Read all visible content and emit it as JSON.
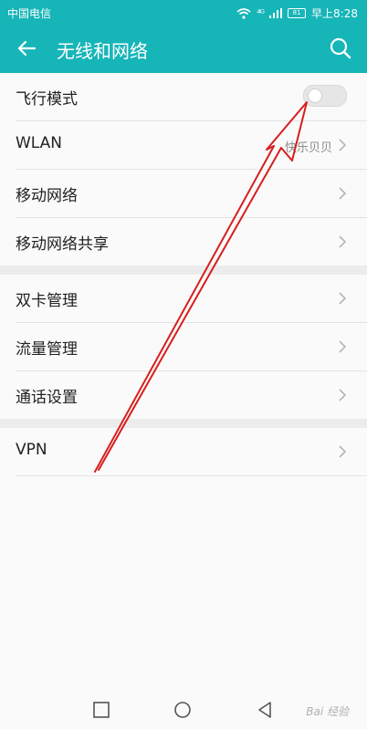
{
  "status_bar": {
    "carrier": "中国电信",
    "signal_label": "⁴ᴳ",
    "battery": "81",
    "time": "早上8:28"
  },
  "header": {
    "title": "无线和网络"
  },
  "groups": [
    [
      {
        "label": "飞行模式",
        "toggle": false
      },
      {
        "label": "WLAN",
        "value": "快乐贝贝"
      },
      {
        "label": "移动网络"
      },
      {
        "label": "移动网络共享"
      }
    ],
    [
      {
        "label": "双卡管理"
      },
      {
        "label": "流量管理"
      },
      {
        "label": "通话设置"
      }
    ],
    [
      {
        "label": "VPN"
      }
    ]
  ],
  "watermark": "Bai 经验",
  "colors": {
    "accent": "#16b5b8",
    "annotation_arrow": "#d81e1e"
  }
}
